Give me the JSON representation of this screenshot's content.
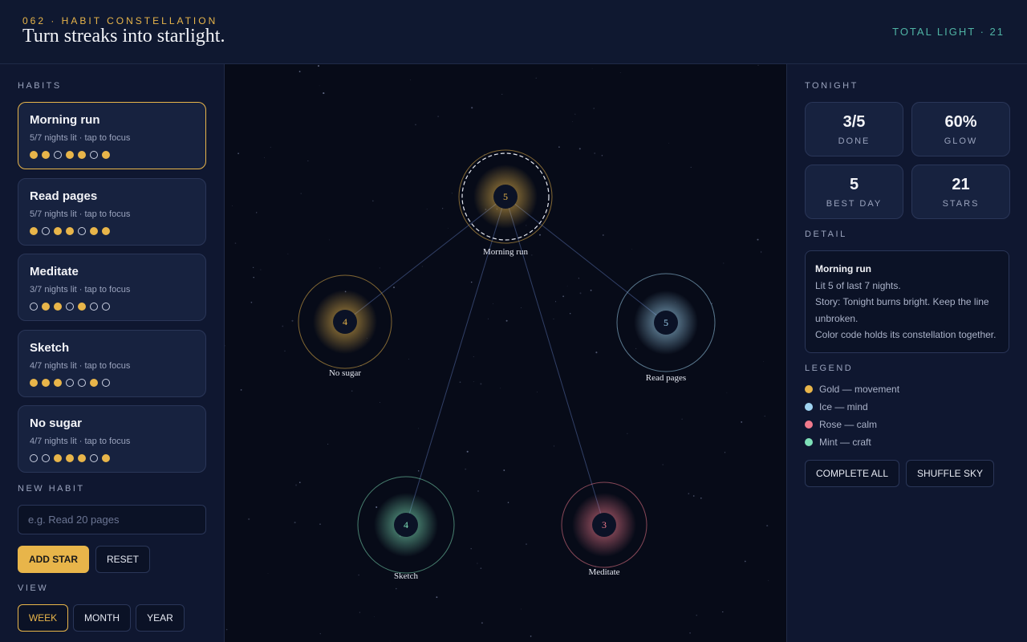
{
  "header": {
    "eyebrow": "062 · HABIT CONSTELLATION",
    "title": "Turn streaks into starlight.",
    "total": "TOTAL LIGHT · 21"
  },
  "sidebar": {
    "habits_label": "HABITS",
    "habits": [
      {
        "name": "Morning run",
        "meta": "5/7 nights lit · tap to focus",
        "nights": [
          1,
          1,
          0,
          1,
          1,
          0,
          1
        ],
        "active": true
      },
      {
        "name": "Read pages",
        "meta": "5/7 nights lit · tap to focus",
        "nights": [
          1,
          0,
          1,
          1,
          0,
          1,
          1
        ],
        "active": false
      },
      {
        "name": "Meditate",
        "meta": "3/7 nights lit · tap to focus",
        "nights": [
          0,
          1,
          1,
          0,
          1,
          0,
          0
        ],
        "active": false
      },
      {
        "name": "Sketch",
        "meta": "4/7 nights lit · tap to focus",
        "nights": [
          1,
          1,
          1,
          0,
          0,
          1,
          0
        ],
        "active": false
      },
      {
        "name": "No sugar",
        "meta": "4/7 nights lit · tap to focus",
        "nights": [
          0,
          0,
          1,
          1,
          1,
          0,
          1
        ],
        "active": false
      }
    ],
    "new_habit_label": "NEW HABIT",
    "new_habit_placeholder": "e.g. Read 20 pages",
    "add_label": "ADD STAR",
    "reset_label": "RESET",
    "view_label": "VIEW",
    "views": [
      "WEEK",
      "MONTH",
      "YEAR"
    ],
    "selected_view": "WEEK"
  },
  "sky": {
    "stars": [
      {
        "name": "Morning run",
        "value": 5,
        "color": "#e8b54a",
        "focused": true
      },
      {
        "name": "No sugar",
        "value": 4,
        "color": "#e8b54a",
        "focused": false
      },
      {
        "name": "Read pages",
        "value": 5,
        "color": "#9fd3f0",
        "focused": false
      },
      {
        "name": "Sketch",
        "value": 4,
        "color": "#7ee0b8",
        "focused": false
      },
      {
        "name": "Meditate",
        "value": 3,
        "color": "#f07a8c",
        "focused": false
      }
    ]
  },
  "right": {
    "tonight_label": "TONIGHT",
    "stats": [
      {
        "value": "3/5",
        "label": "DONE"
      },
      {
        "value": "60%",
        "label": "GLOW"
      },
      {
        "value": "5",
        "label": "BEST DAY"
      },
      {
        "value": "21",
        "label": "STARS"
      }
    ],
    "detail_label": "DETAIL",
    "detail": {
      "title": "Morning run",
      "line1": "Lit 5 of last 7 nights.",
      "line2": "Story: Tonight burns bright. Keep the line unbroken.",
      "line3": "Color code holds its constellation together."
    },
    "legend_label": "LEGEND",
    "legend": [
      {
        "label": "Gold — movement",
        "color": "#e8b54a"
      },
      {
        "label": "Ice — mind",
        "color": "#9fd3f0"
      },
      {
        "label": "Rose — calm",
        "color": "#f07a8c"
      },
      {
        "label": "Mint — craft",
        "color": "#7ee0b8"
      }
    ],
    "complete_all_label": "COMPLETE ALL",
    "shuffle_label": "SHUFFLE SKY"
  }
}
